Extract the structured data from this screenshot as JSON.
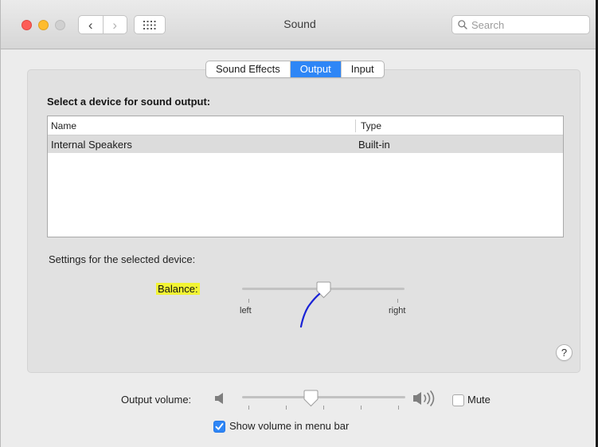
{
  "window": {
    "title": "Sound",
    "search_placeholder": "Search"
  },
  "icons": {
    "back": "chevron-left-icon",
    "forward": "chevron-right-icon",
    "show_all": "grid-icon",
    "search": "search-icon",
    "help": "question-icon",
    "volume_low": "speaker-low-icon",
    "volume_high": "speaker-high-icon"
  },
  "glyphs": {
    "back": "‹",
    "forward": "›",
    "help": "?"
  },
  "tabs": [
    {
      "label": "Sound Effects",
      "active": false
    },
    {
      "label": "Output",
      "active": true
    },
    {
      "label": "Input",
      "active": false
    }
  ],
  "output": {
    "heading": "Select a device for sound output:",
    "columns": [
      "Name",
      "Type"
    ],
    "devices": [
      {
        "name": "Internal Speakers",
        "type": "Built-in",
        "selected": true
      }
    ],
    "settings_label": "Settings for the selected device:",
    "balance": {
      "label": "Balance:",
      "left_label": "left",
      "right_label": "right",
      "value": 0.5
    }
  },
  "volume": {
    "label": "Output volume:",
    "value": 0.42,
    "mute_label": "Mute",
    "muted": false,
    "show_in_menu_bar_label": "Show volume in menu bar",
    "show_in_menu_bar": true
  },
  "colors": {
    "accent": "#2e86f6",
    "highlight": "#f1f334",
    "annotation": "#1a23d6",
    "selected_row": "#dcdcdc"
  }
}
